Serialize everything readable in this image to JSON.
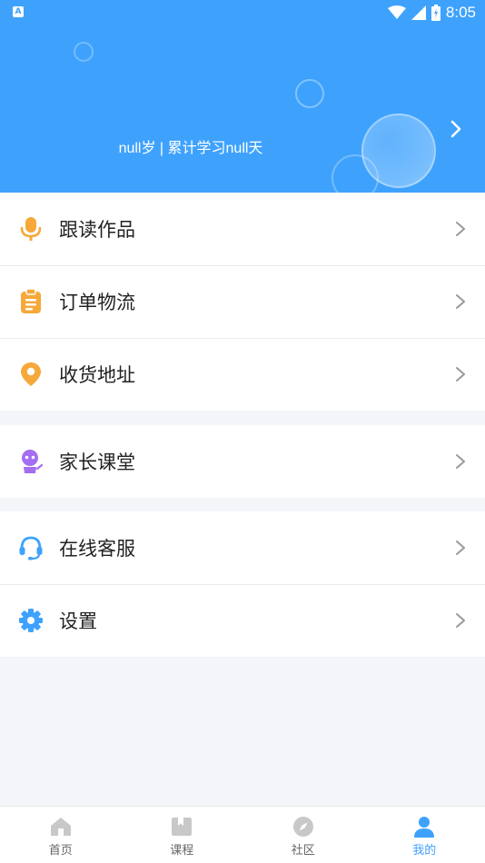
{
  "status_bar": {
    "app_badge": "A",
    "time": "8:05"
  },
  "header": {
    "info_text": "null岁 | 累计学习null天"
  },
  "menu": {
    "group1": [
      {
        "label": "跟读作品",
        "icon": "microphone-icon",
        "color": "#f6a83a"
      },
      {
        "label": "订单物流",
        "icon": "clipboard-icon",
        "color": "#f6a83a"
      },
      {
        "label": "收货地址",
        "icon": "location-pin-icon",
        "color": "#f6a83a"
      }
    ],
    "group2": [
      {
        "label": "家长课堂",
        "icon": "robot-icon",
        "color": "#a56df0"
      }
    ],
    "group3": [
      {
        "label": "在线客服",
        "icon": "headset-icon",
        "color": "#3ea2fd"
      },
      {
        "label": "设置",
        "icon": "gear-icon",
        "color": "#3ea2fd"
      }
    ]
  },
  "bottom_nav": {
    "items": [
      {
        "label": "首页",
        "icon": "home-icon",
        "active": false
      },
      {
        "label": "课程",
        "icon": "book-icon",
        "active": false
      },
      {
        "label": "社区",
        "icon": "compass-icon",
        "active": false
      },
      {
        "label": "我的",
        "icon": "user-icon",
        "active": true
      }
    ]
  },
  "colors": {
    "accent": "#3ea2fd",
    "orange_icon": "#f6a83a",
    "purple_icon": "#a56df0",
    "inactive_nav": "#c8c8c8",
    "background": "#f3f5f9"
  }
}
